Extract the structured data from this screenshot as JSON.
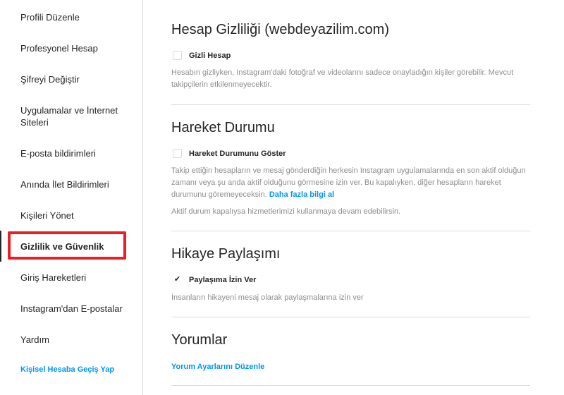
{
  "sidebar": {
    "items": [
      {
        "label": "Profili Düzenle"
      },
      {
        "label": "Profesyonel Hesap"
      },
      {
        "label": "Şifreyi Değiştir"
      },
      {
        "label": "Uygulamalar ve İnternet Siteleri"
      },
      {
        "label": "E-posta bildirimleri"
      },
      {
        "label": "Anında İlet Bildirimleri"
      },
      {
        "label": "Kişileri Yönet"
      },
      {
        "label": "Gizlilik ve Güvenlik"
      },
      {
        "label": "Giriş Hareketleri"
      },
      {
        "label": "Instagram'dan E-postalar"
      },
      {
        "label": "Yardım"
      }
    ],
    "switch_link": "Kişisel Hesaba Geçiş Yap"
  },
  "sections": {
    "privacy": {
      "title": "Hesap Gizliliği (webdeyazilim.com)",
      "checkbox_label": "Gizli Hesap",
      "checked": false,
      "description": "Hesabın gizliyken, Instagram'daki fotoğraf ve videolarını sadece onayladığın kişiler görebilir. Mevcut takipçilerin etkilenmeyecektir."
    },
    "activity": {
      "title": "Hareket Durumu",
      "checkbox_label": "Hareket Durumunu Göster",
      "checked": false,
      "description": "Takip ettiğin hesapların ve mesaj gönderdiğin herkesin Instagram uygulamalarında en son aktif olduğun zamanı veya şu anda aktif olduğunu görmesine izin ver. Bu kapalıyken, diğer hesapların hareket durumunu göremeyeceksin.",
      "learn_more": "Daha fazla bilgi al",
      "note": "Aktif durum kapalıysa hizmetlerimizi kullanmaya devam edebilirsin."
    },
    "story": {
      "title": "Hikaye Paylaşımı",
      "checkbox_label": "Paylaşıma İzin Ver",
      "checked": true,
      "checkmark": "✔",
      "description": "İnsanların hikayeni mesaj olarak paylaşmalarına izin ver"
    },
    "comments": {
      "title": "Yorumlar",
      "link": "Yorum Ayarlarını Düzenle"
    }
  },
  "colors": {
    "accent": "#0095f6",
    "highlight_box": "#ee1c24"
  }
}
